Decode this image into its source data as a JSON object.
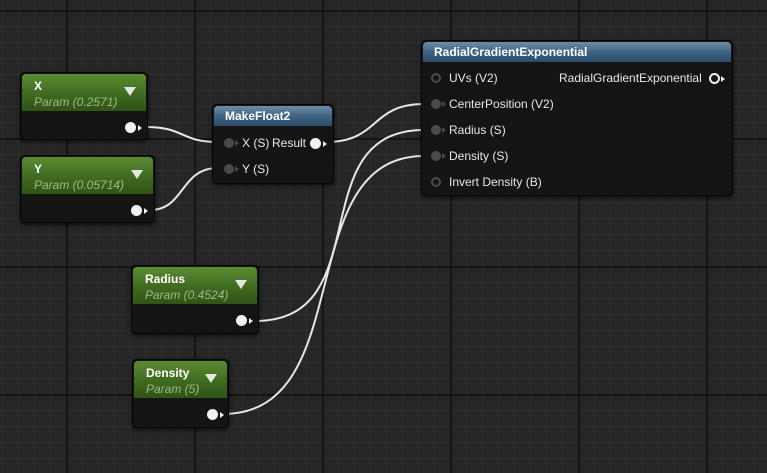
{
  "nodes": {
    "x_param": {
      "name": "X",
      "value": "Param (0.2571)"
    },
    "y_param": {
      "name": "Y",
      "value": "Param (0.05714)"
    },
    "radius_param": {
      "name": "Radius",
      "value": "Param (0.4524)"
    },
    "density_param": {
      "name": "Density",
      "value": "Param (5)"
    },
    "make_float2": {
      "title": "MakeFloat2",
      "inputs": [
        "X (S)",
        "Y (S)"
      ],
      "output": "Result"
    },
    "radial_gradient": {
      "title": "RadialGradientExponential",
      "inputs": [
        "UVs (V2)",
        "CenterPosition (V2)",
        "Radius (S)",
        "Density (S)",
        "Invert Density (B)"
      ],
      "output": "RadialGradientExponential"
    }
  },
  "colors": {
    "background": "#262626",
    "param_header": "#4f7c2a",
    "function_header": "#3f6383",
    "wire": "#e6e6e6"
  }
}
